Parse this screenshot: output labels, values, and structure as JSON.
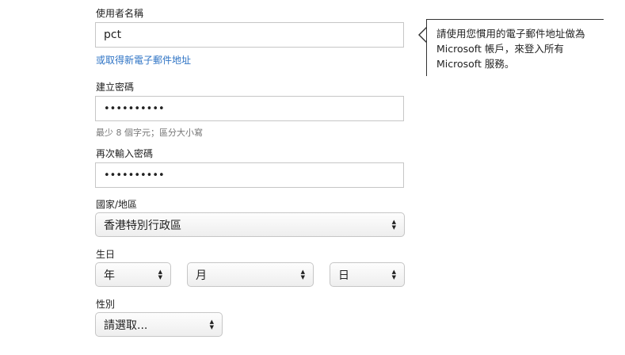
{
  "username": {
    "label": "使用者名稱",
    "value": "pct",
    "alt_link": "或取得新電子郵件地址"
  },
  "password": {
    "label": "建立密碼",
    "value": "••••••••••",
    "hint": "最少 8 個字元；區分大小寫"
  },
  "confirm_password": {
    "label": "再次輸入密碼",
    "value": "••••••••••"
  },
  "country": {
    "label": "國家/地區",
    "selected": "香港特別行政區"
  },
  "birthdate": {
    "label": "生日",
    "year": "年",
    "month": "月",
    "day": "日"
  },
  "gender": {
    "label": "性別",
    "selected": "請選取..."
  },
  "tooltip": {
    "text": "請使用您慣用的電子郵件地址做為 Microsoft 帳戶，來登入所有 Microsoft 服務。"
  }
}
